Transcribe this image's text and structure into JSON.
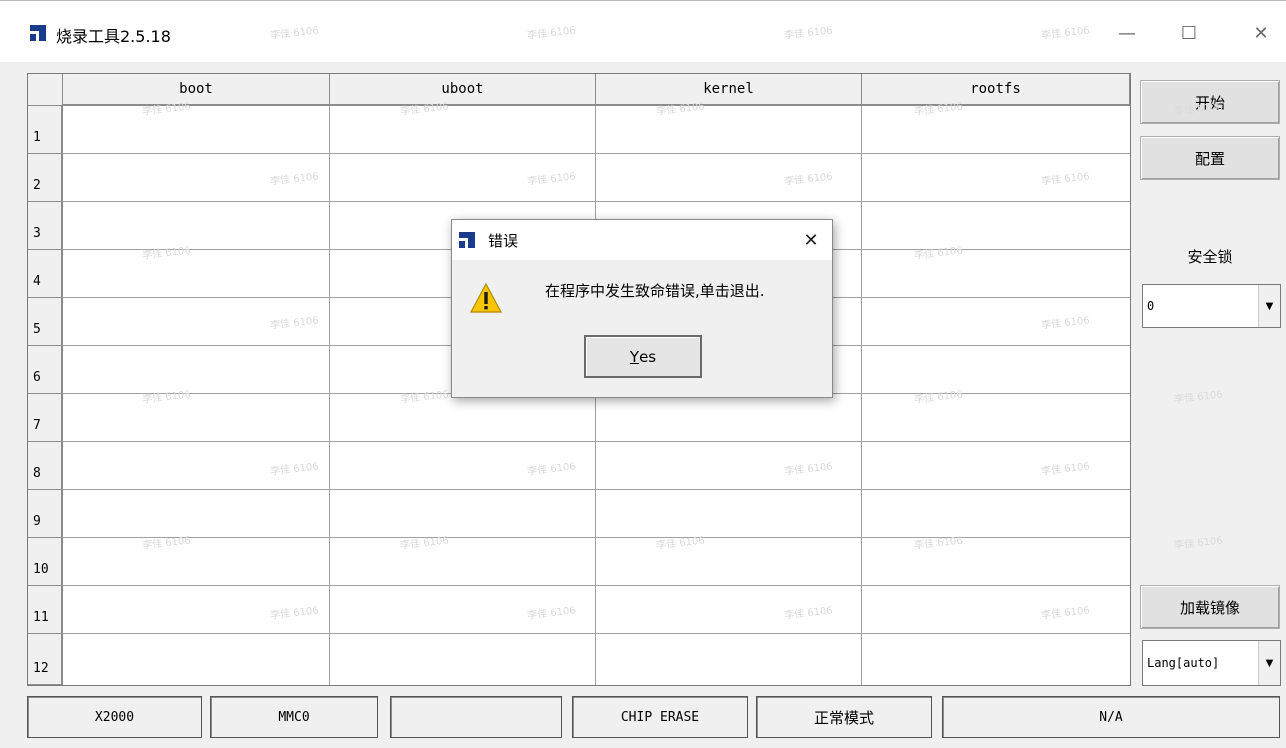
{
  "window": {
    "title": "烧录工具2.5.18",
    "minimize_icon": "minimize-icon",
    "maximize_icon": "maximize-icon",
    "close_icon": "close-icon"
  },
  "grid": {
    "columns": [
      "boot",
      "uboot",
      "kernel",
      "rootfs"
    ],
    "rows": [
      "1",
      "2",
      "3",
      "4",
      "5",
      "6",
      "7",
      "8",
      "9",
      "10",
      "11",
      "12"
    ]
  },
  "side_panel": {
    "start_label": "开始",
    "config_label": "配置",
    "lock_label": "安全锁",
    "lock_value": "0",
    "load_image_label": "加载镜像",
    "lang_value": "Lang[auto]"
  },
  "status_bar": {
    "chip": "X2000",
    "storage": "MMC0",
    "empty": "",
    "erase": "CHIP ERASE",
    "mode": "正常模式",
    "info": "N/A"
  },
  "watermark": "李佳 6106",
  "dialog": {
    "title": "错误",
    "message": "在程序中发生致命错误,单击退出.",
    "yes_mnemonic": "Y",
    "yes_rest": "es"
  },
  "colors": {
    "logo_blue": "#1a3a8c",
    "warning_yellow": "#f7c600"
  }
}
